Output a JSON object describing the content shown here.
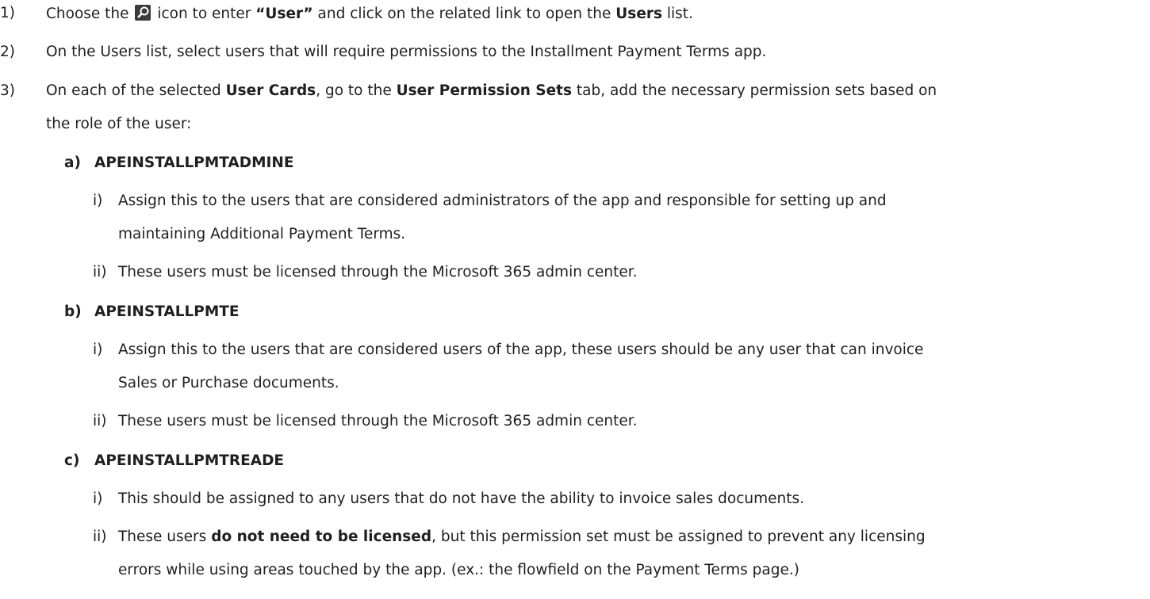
{
  "steps": [
    {
      "num": "1)",
      "parts": {
        "a": "Choose the",
        "b": "icon to enter",
        "c": "“User”",
        "d": "and click on the related link to open the",
        "e": "Users",
        "f": "list."
      }
    },
    {
      "num": "2)",
      "text": "On the Users list, select users that will require permissions to the Installment Payment Terms app."
    },
    {
      "num": "3)",
      "parts": {
        "a": "On each of the selected",
        "b": "User Cards",
        "c": ", go to the",
        "d": "User Permission Sets",
        "e": "tab, add the necessary permission sets based on",
        "f": "the role of the user:"
      }
    }
  ],
  "roles": [
    {
      "letter": "a)",
      "name": "APEINSTALLPMTADMINE",
      "items": [
        {
          "num": "i)",
          "line1": "Assign this to the users that are considered administrators of the app and responsible for setting up and",
          "line2": "maintaining Additional Payment Terms."
        },
        {
          "num": "ii)",
          "line1": "These users must be licensed through the Microsoft 365 admin center."
        }
      ]
    },
    {
      "letter": "b)",
      "name": "APEINSTALLPMTE",
      "items": [
        {
          "num": "i)",
          "line1": "Assign this to the users that are considered users of the app, these users should be any user that can invoice",
          "line2": "Sales or Purchase documents."
        },
        {
          "num": "ii)",
          "line1": "These users must be licensed through the Microsoft 365 admin center."
        }
      ]
    },
    {
      "letter": "c)",
      "name": "APEINSTALLPMTREADE",
      "items": [
        {
          "num": "i)",
          "line1": "This should be assigned to any users that do not have the ability to invoice sales documents."
        },
        {
          "num": "ii)",
          "line1_pre": "These users",
          "line1_bold": "do not need to be licensed",
          "line1_post": ", but this permission set must be assigned to prevent any licensing",
          "line2": "errors while using areas touched by the app. (ex.: the flowfield on the Payment Terms page.)"
        }
      ]
    }
  ]
}
